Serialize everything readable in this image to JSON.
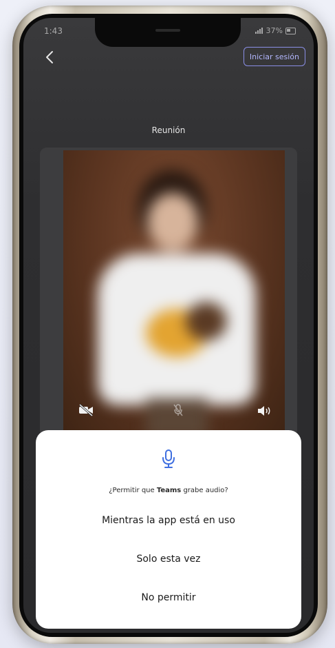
{
  "status_bar": {
    "time": "1:43",
    "battery": "37%"
  },
  "header": {
    "back_icon": "chevron-left-icon",
    "signin_label": "Iniciar sesión"
  },
  "meeting": {
    "title": "Reunión"
  },
  "video_controls": {
    "camera_icon": "camera-off-icon",
    "mic_icon": "mic-off-icon",
    "speaker_icon": "speaker-icon"
  },
  "permission_dialog": {
    "icon": "microphone-icon",
    "question_prefix": "¿Permitir que ",
    "app_name": "Teams",
    "question_suffix": " grabe audio?",
    "options": [
      {
        "label": "Mientras la app está en uso"
      },
      {
        "label": "Solo esta vez"
      },
      {
        "label": "No permitir"
      }
    ],
    "accent_color": "#3f6fe0"
  }
}
